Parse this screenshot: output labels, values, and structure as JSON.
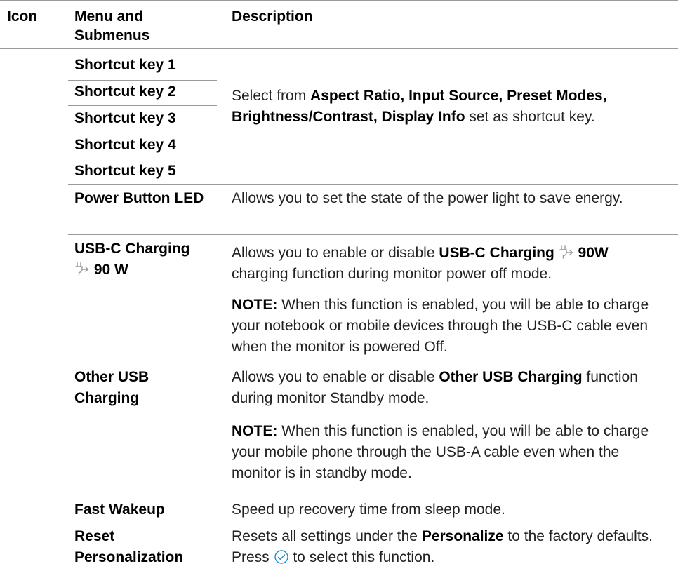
{
  "header": {
    "icon": "Icon",
    "menu_line1": "Menu and",
    "menu_line2": "Submenus",
    "description": "Description"
  },
  "shortcuts": {
    "key1": "Shortcut key 1",
    "key2": "Shortcut key 2",
    "key3": "Shortcut key 3",
    "key4": "Shortcut key 4",
    "key5": "Shortcut key 5",
    "desc_prefix": "Select from ",
    "desc_bold": "Aspect Ratio, Input Source, Preset Modes, Brightness/Contrast, Display Info",
    "desc_suffix": " set as shortcut key."
  },
  "power_led": {
    "menu": "Power Button LED",
    "desc": "Allows you to set the state of the power light to save energy."
  },
  "usbc": {
    "menu_line1": "USB-C Charging",
    "menu_watt": "90 W",
    "plug_icon": "usb-power-icon",
    "desc_prefix": "Allows you to enable or disable ",
    "desc_bold1": "USB-C Charging",
    "desc_bold2": "90W",
    "desc_suffix": " charging function during monitor power off mode.",
    "note_label": "NOTE:",
    "note_text": " When this function is enabled, you will be able to charge your notebook or mobile devices through the USB-C cable even when the monitor is powered Off."
  },
  "other_usb": {
    "menu": "Other USB Charging",
    "desc_prefix": "Allows you to enable or disable ",
    "desc_bold": "Other USB Charging",
    "desc_suffix": " function during monitor Standby mode.",
    "note_label": "NOTE:",
    "note_text": " When this function is enabled, you will be able to charge your mobile phone through the USB-A cable even when the monitor is in standby mode."
  },
  "fast_wakeup": {
    "menu": "Fast Wakeup",
    "desc": "Speed up recovery time from sleep mode."
  },
  "reset": {
    "menu": "Reset Personalization",
    "desc_prefix": "Resets all settings under the ",
    "desc_bold": "Personalize",
    "desc_mid": " to the factory defaults. Press ",
    "check_icon": "check-circle-icon",
    "desc_suffix": " to select this function."
  },
  "colors": {
    "rule": "#9a9a9a",
    "icon": "#999999",
    "check": "#1a8fd6"
  }
}
